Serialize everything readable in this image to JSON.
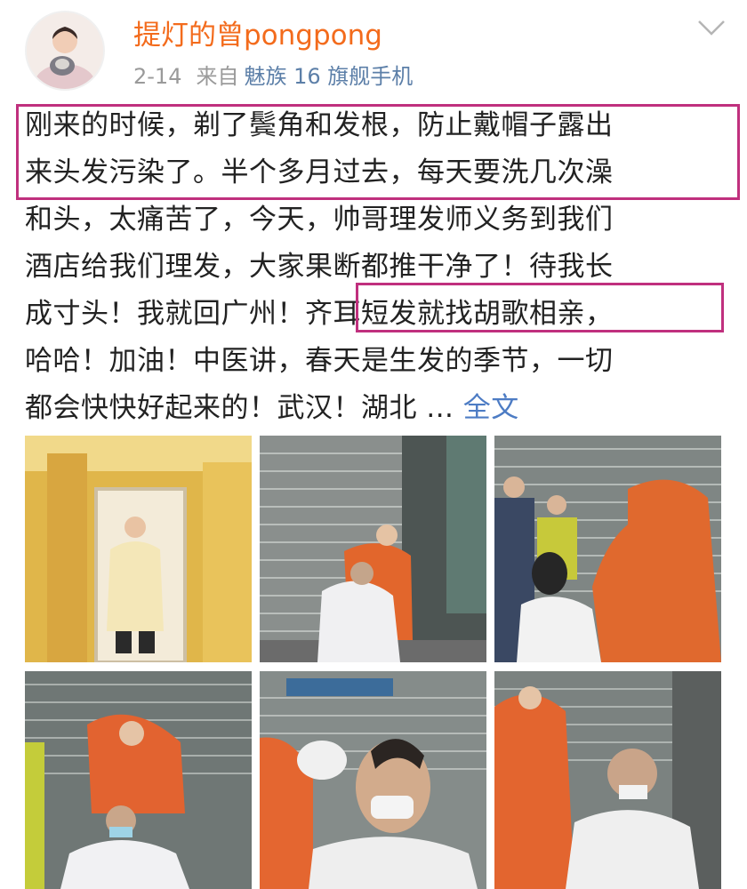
{
  "user": {
    "name": "提灯的曾pongpong",
    "date": "2-14",
    "source_prefix": "来自",
    "device": "魅族 16 旗舰手机"
  },
  "post": {
    "lines": [
      "刚来的时候，剃了鬓角和发根，防止戴帽子露出",
      "来头发污染了。半个多月过去，每天要洗几次澡",
      "和头，太痛苦了，今天，帅哥理发师义务到我们",
      "酒店给我们理发，大家果断都推干净了！待我长",
      "成寸头！我就回广州！齐耳短发就找胡歌相亲，",
      "哈哈！加油！中医讲，春天是生发的季节，一切",
      "都会快快好起来的！武汉！湖北 ..."
    ],
    "more_label": "全文"
  },
  "icons": {
    "expand": "chevron-down-icon"
  },
  "colors": {
    "username": "#f36b1c",
    "link": "#4d7cc4",
    "highlight_box": "#c0307e",
    "meta": "#9a9a9a"
  },
  "photos": [
    {
      "name": "photo-woman-yellow-coat-in-hallway"
    },
    {
      "name": "photo-haircut-street-1"
    },
    {
      "name": "photo-haircut-woman-orange-suit"
    },
    {
      "name": "photo-child-haircut"
    },
    {
      "name": "photo-man-haircut-clippers"
    },
    {
      "name": "photo-bald-man-after-haircut"
    }
  ]
}
